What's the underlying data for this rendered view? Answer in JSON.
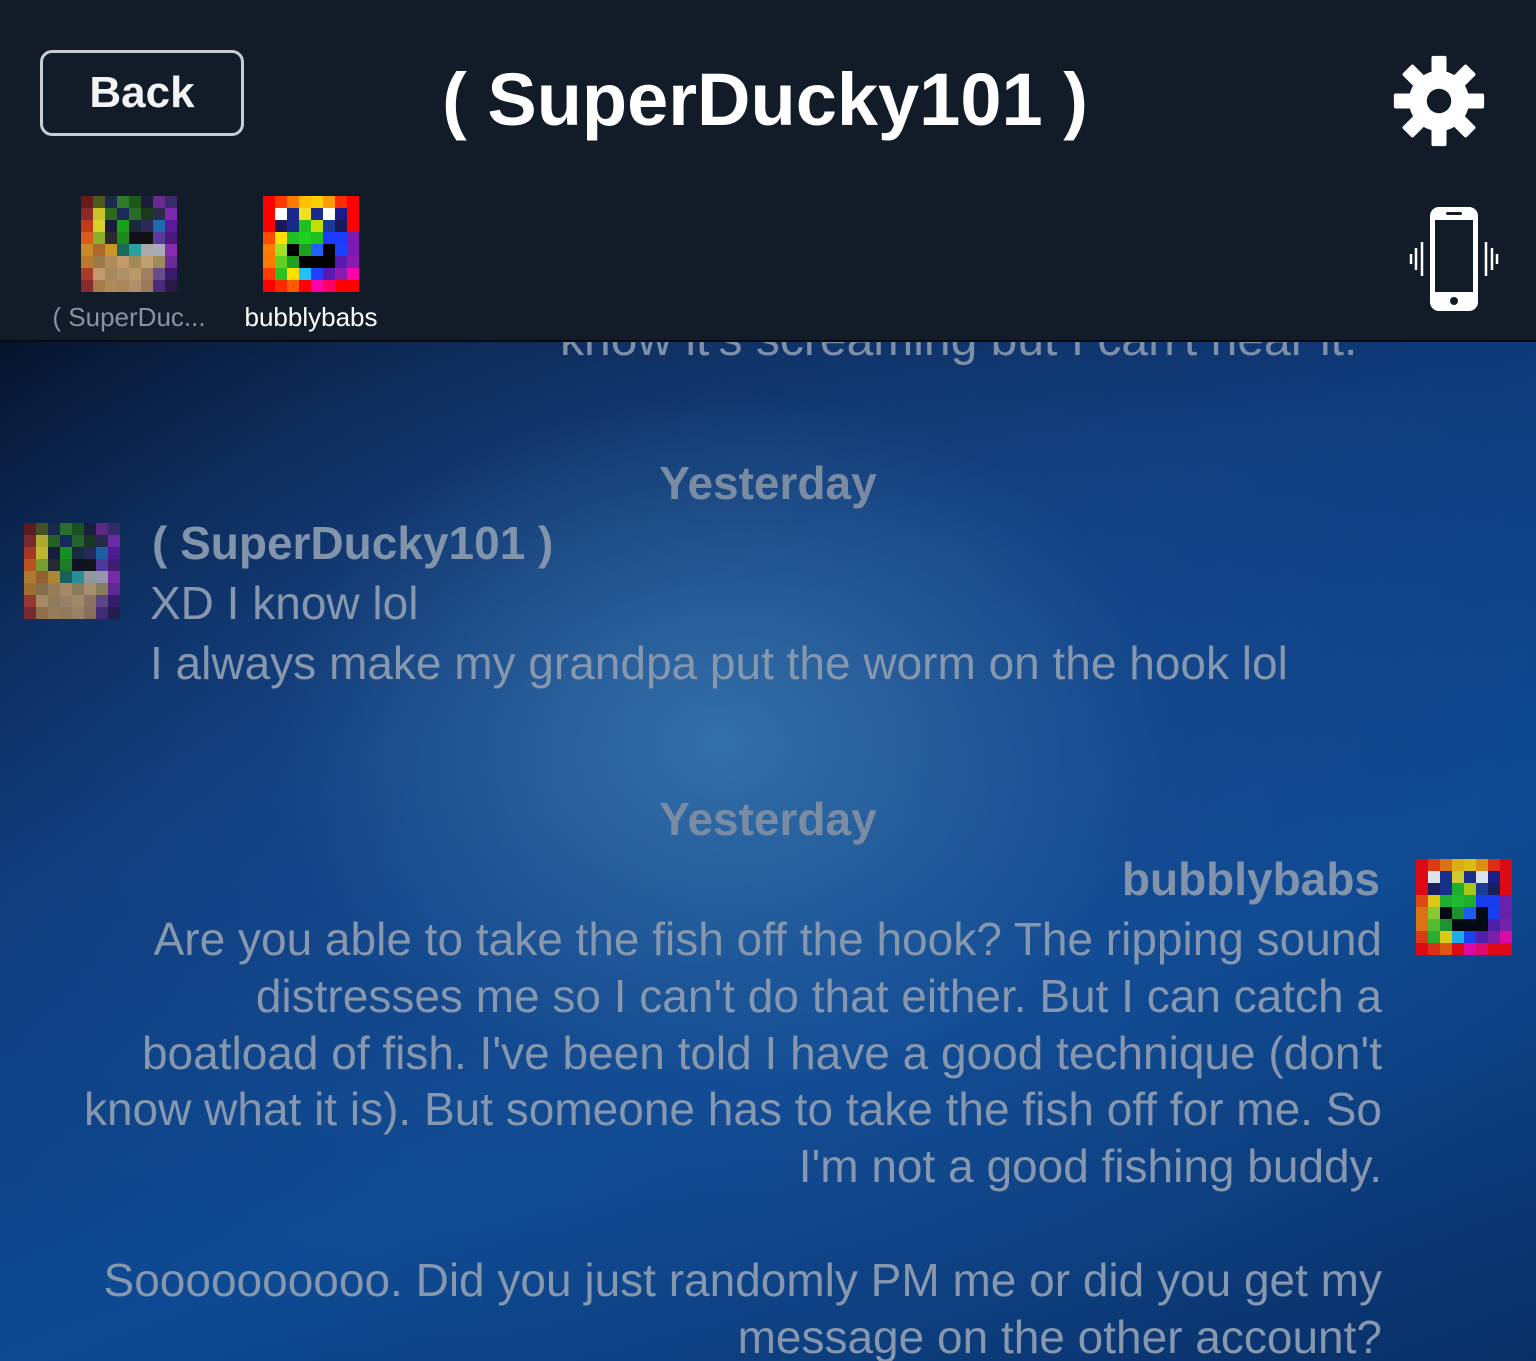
{
  "header": {
    "back_label": "Back",
    "title": "( SuperDucky101 )",
    "settings_icon": "gear-icon",
    "vibrate_icon": "phone-vibrate-icon",
    "members": [
      {
        "label": "( SuperDuc..."
      },
      {
        "label": "bubblybabs"
      }
    ]
  },
  "chat": {
    "cut_off_text": "know it's screaming but I can't hear it.",
    "messages": [
      {
        "date": "Yesterday",
        "sender": "( SuperDucky101 )",
        "lines": [
          "XD I know lol",
          "I always make my grandpa put the worm on the hook lol"
        ]
      },
      {
        "date": "Yesterday",
        "sender": "bubblybabs",
        "lines": [
          "Are you able to take the fish off the hook?  The ripping sound",
          "distresses me so I can't do that either.  But I can catch a",
          "boatload of fish.  I've been told I have a good technique (don't",
          "know what it is).  But someone has to take the fish off for me.  So",
          "I'm not a good fishing buddy.",
          "",
          "Soooooooooo.  Did you just randomly PM me or did you get my",
          "message on the other account?"
        ]
      }
    ]
  },
  "avatars": {
    "superducky": [
      "#6b1a1a",
      "#4d5a1e",
      "#1b2a4a",
      "#2f7a2a",
      "#1b5a1a",
      "#1c1c3a",
      "#6a2a8a",
      "#3a2a6a",
      "#8a2a2a",
      "#c9c12a",
      "#2a6a1a",
      "#1a2a5a",
      "#2a6a2a",
      "#1a3a1a",
      "#2a2a4a",
      "#7a2ab0",
      "#c23a1a",
      "#d9d02a",
      "#1a1a3a",
      "#18a018",
      "#1a2a3a",
      "#2a2a5a",
      "#1e6ab0",
      "#5a1a9a",
      "#d95a1a",
      "#8ab02a",
      "#2a2a2a",
      "#1e8a1e",
      "#0f0f1a",
      "#111111",
      "#5a3aa0",
      "#4a1a7a",
      "#c88a2a",
      "#aa6a2a",
      "#c8962a",
      "#1a6a5a",
      "#2aa0a0",
      "#aaaaaa",
      "#aaaabb",
      "#8a2ab0",
      "#b87a2a",
      "#9a7a4a",
      "#b08a5a",
      "#c09a6a",
      "#a08a5a",
      "#c0a070",
      "#a08a5a",
      "#6a2a9a",
      "#aa3a2a",
      "#c09a6a",
      "#a88a5a",
      "#b0906a",
      "#b89a6a",
      "#a08060",
      "#6a4a8a",
      "#3a1a6a",
      "#8a2a2a",
      "#a87a4a",
      "#b08a5a",
      "#a8885a",
      "#b0906a",
      "#9a7a5a",
      "#4a2a7a",
      "#2a1a4a"
    ],
    "bubblybabs": [
      "#ff0000",
      "#ff3a00",
      "#ff7a00",
      "#ffc000",
      "#ffd000",
      "#ff9a00",
      "#ff2a00",
      "#ff0000",
      "#ff0000",
      "#ffffff",
      "#1a2a8a",
      "#f0e020",
      "#1a2a8a",
      "#ffffff",
      "#1a1a8a",
      "#ff0000",
      "#ff0000",
      "#1a1a5a",
      "#1a2a8a",
      "#20c020",
      "#c0e000",
      "#1a3a9a",
      "#1a1a5a",
      "#ff0000",
      "#ff4a00",
      "#ffe000",
      "#20c020",
      "#20d020",
      "#20c020",
      "#1a3aff",
      "#1a3aff",
      "#7a1ab0",
      "#ff7a00",
      "#a0e020",
      "#000000",
      "#20a020",
      "#2060ff",
      "#000000",
      "#1a40ff",
      "#7a1ab0",
      "#ff7a00",
      "#60d020",
      "#20a020",
      "#000000",
      "#000000",
      "#000000",
      "#5a1ab0",
      "#8a1ab0",
      "#ff3a00",
      "#30c020",
      "#ffe000",
      "#20c0ff",
      "#2040ff",
      "#5a1ab0",
      "#8a1ab0",
      "#ff00aa",
      "#ff0000",
      "#ff2a00",
      "#ff5a00",
      "#ff0000",
      "#ff00aa",
      "#ff0066",
      "#ff0000",
      "#ff0000"
    ]
  },
  "colors": {
    "header_bg": "#121c29",
    "title_text": "#ffffff",
    "chat_text": "#8697ae"
  }
}
